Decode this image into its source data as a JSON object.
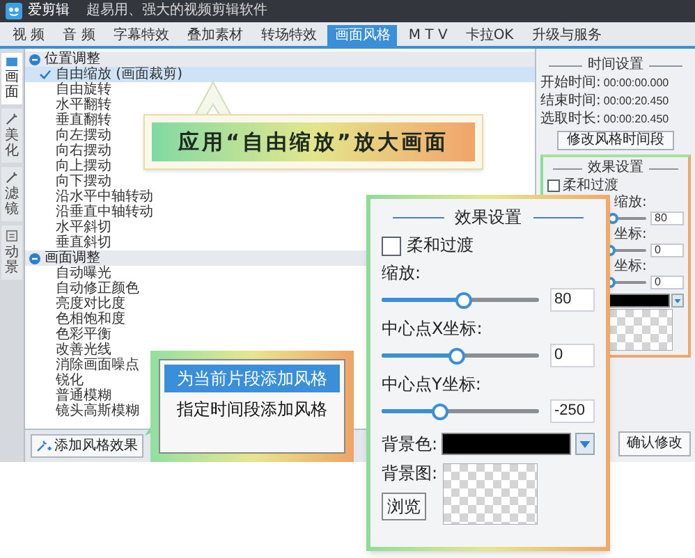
{
  "title_bar": {
    "app_name": "爱剪辑",
    "slogan": "超易用、强大的视频剪辑软件"
  },
  "tabs": [
    {
      "label": "视 频",
      "selected": false
    },
    {
      "label": "音 频",
      "selected": false
    },
    {
      "label": "字幕特效",
      "selected": false
    },
    {
      "label": "叠加素材",
      "selected": false
    },
    {
      "label": "转场特效",
      "selected": false
    },
    {
      "label": "画面风格",
      "selected": true
    },
    {
      "label": "M T V",
      "selected": false
    },
    {
      "label": "卡拉OK",
      "selected": false
    },
    {
      "label": "升级与服务",
      "selected": false
    }
  ],
  "side_tabs": [
    {
      "label": "画面",
      "selected": true,
      "kind": "screen"
    },
    {
      "label": "美化",
      "selected": false,
      "kind": "wand"
    },
    {
      "label": "滤镜",
      "selected": false,
      "kind": "wand"
    },
    {
      "label": "动景",
      "selected": false,
      "kind": "frame"
    }
  ],
  "style_tree": [
    {
      "label": "位置调整",
      "expanded": true,
      "children": [
        {
          "label": "自由缩放 (画面裁剪)",
          "checked": true,
          "selected": true
        },
        {
          "label": "自由旋转",
          "checked": false,
          "selected": false
        },
        {
          "label": "水平翻转",
          "checked": false,
          "selected": false
        },
        {
          "label": "垂直翻转",
          "checked": false,
          "selected": false
        },
        {
          "label": "向左摆动",
          "checked": false,
          "selected": false
        },
        {
          "label": "向右摆动",
          "checked": false,
          "selected": false
        },
        {
          "label": "向上摆动",
          "checked": false,
          "selected": false
        },
        {
          "label": "向下摆动",
          "checked": false,
          "selected": false
        },
        {
          "label": "沿水平中轴转动",
          "checked": false,
          "selected": false
        },
        {
          "label": "沿垂直中轴转动",
          "checked": false,
          "selected": false
        },
        {
          "label": "水平斜切",
          "checked": false,
          "selected": false
        },
        {
          "label": "垂直斜切",
          "checked": false,
          "selected": false
        }
      ]
    },
    {
      "label": "画面调整",
      "expanded": true,
      "children": [
        {
          "label": "自动曝光",
          "checked": false,
          "selected": false
        },
        {
          "label": "自动修正颜色",
          "checked": false,
          "selected": false
        },
        {
          "label": "亮度对比度",
          "checked": false,
          "selected": false
        },
        {
          "label": "色相饱和度",
          "checked": false,
          "selected": false
        },
        {
          "label": "色彩平衡",
          "checked": false,
          "selected": false
        },
        {
          "label": "改善光线",
          "checked": false,
          "selected": false
        },
        {
          "label": "消除画面噪点",
          "checked": false,
          "selected": false
        },
        {
          "label": "锐化",
          "checked": false,
          "selected": false
        },
        {
          "label": "普通模糊",
          "checked": false,
          "selected": false
        },
        {
          "label": "镜头高斯模糊",
          "checked": false,
          "selected": false
        }
      ]
    }
  ],
  "add_button": "添加风格效果",
  "time_settings": {
    "title": "时间设置",
    "rows": [
      {
        "label": "开始时间:",
        "value": "00:00:00.000"
      },
      {
        "label": "结束时间:",
        "value": "00:00:20.450"
      },
      {
        "label": "选取时长:",
        "value": "00:00:20.450"
      }
    ],
    "button": "修改风格时间段"
  },
  "effect_panel": {
    "title": "效果设置",
    "soft_transition": {
      "label": "柔和过渡",
      "checked": false
    },
    "sliders": [
      {
        "label": "缩放:",
        "level": 0.66,
        "value": "80"
      },
      {
        "label": "坐标:",
        "level": 0.64,
        "value": "0"
      },
      {
        "label": "坐标:",
        "level": 0.64,
        "value": "0"
      }
    ]
  },
  "confirm_button": "确认修改",
  "callout_banner": "应用“自由缩放”放大画面",
  "add_menu": [
    {
      "label": "为当前片段添加风格",
      "selected": true
    },
    {
      "label": "指定时间段添加风格",
      "selected": false
    }
  ],
  "effect_popup": {
    "title": "效果设置",
    "soft_transition": {
      "label": "柔和过渡",
      "checked": false
    },
    "sliders": [
      {
        "label": "缩放:",
        "level": 0.52,
        "value": "80"
      },
      {
        "label": "中心点X坐标:",
        "level": 0.48,
        "value": "0"
      },
      {
        "label": "中心点Y坐标:",
        "level": 0.37,
        "value": "-250"
      }
    ],
    "background_color_label": "背景色:",
    "background_image_label": "背景图:",
    "browse_button": "浏览"
  }
}
